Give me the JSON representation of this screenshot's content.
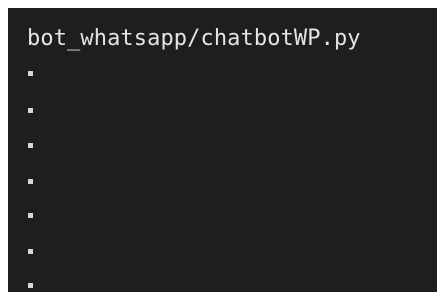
{
  "editor": {
    "file_path": "bot_whatsapp/chatbotWP.py",
    "lines": [
      ".",
      ".",
      ".",
      ".",
      ".",
      ".",
      "."
    ]
  },
  "colors": {
    "background": "#1e1e1e",
    "text": "#e4e4e4",
    "dot": "#d8d8d8"
  }
}
